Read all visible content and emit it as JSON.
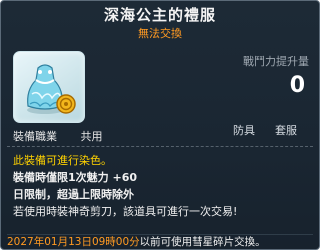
{
  "item": {
    "name": "深海公主的禮服",
    "trade_status": "無法交換",
    "icon": "princess-dress-icon"
  },
  "stats": {
    "power_label": "戰鬥力提升量",
    "power_value": "0"
  },
  "equip": {
    "job_label": "裝備職業",
    "job_value": "共用",
    "tag_armor": "防具",
    "tag_set": "套服"
  },
  "description": {
    "line1": "此裝備可進行染色。",
    "line2": "裝備時僅限1次魅力  +60",
    "line3": "日限制，超過上限時除外",
    "line4": "若使用時裝神奇剪刀，該道具可進行一次交易!"
  },
  "expiry": {
    "date": "2027年01月13日09時00分",
    "text": "以前可使用彗星碎片交換。"
  },
  "colors": {
    "title": "#f4f4f4",
    "orange": "#ff9a22",
    "yellow": "#ffd200",
    "background": "#1b2834"
  }
}
